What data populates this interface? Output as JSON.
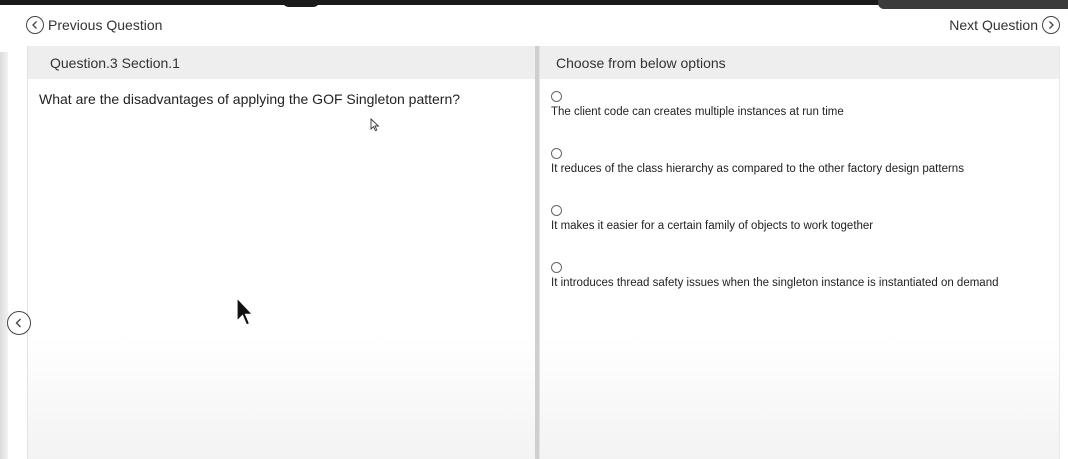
{
  "nav": {
    "prev_label": "Previous Question",
    "next_label": "Next Question"
  },
  "question_panel": {
    "header": "Question.3 Section.1",
    "question": "What are the disadvantages of applying the GOF Singleton pattern?"
  },
  "options_panel": {
    "header": "Choose from below options",
    "options": [
      {
        "label": "The client code can creates multiple instances at run time",
        "selected": false
      },
      {
        "label": "It reduces of the class hierarchy as compared to the other factory design patterns",
        "selected": false
      },
      {
        "label": "It makes it easier for a certain family of objects to work together",
        "selected": false
      },
      {
        "label": "It introduces thread safety issues when the singleton instance is instantiated on demand",
        "selected": false
      }
    ]
  },
  "icons": {
    "prev": "chevron-left-circle-icon",
    "next": "chevron-right-circle-icon",
    "side_toggle": "chevron-left-circle-icon",
    "cursor": "mouse-pointer-icon"
  }
}
